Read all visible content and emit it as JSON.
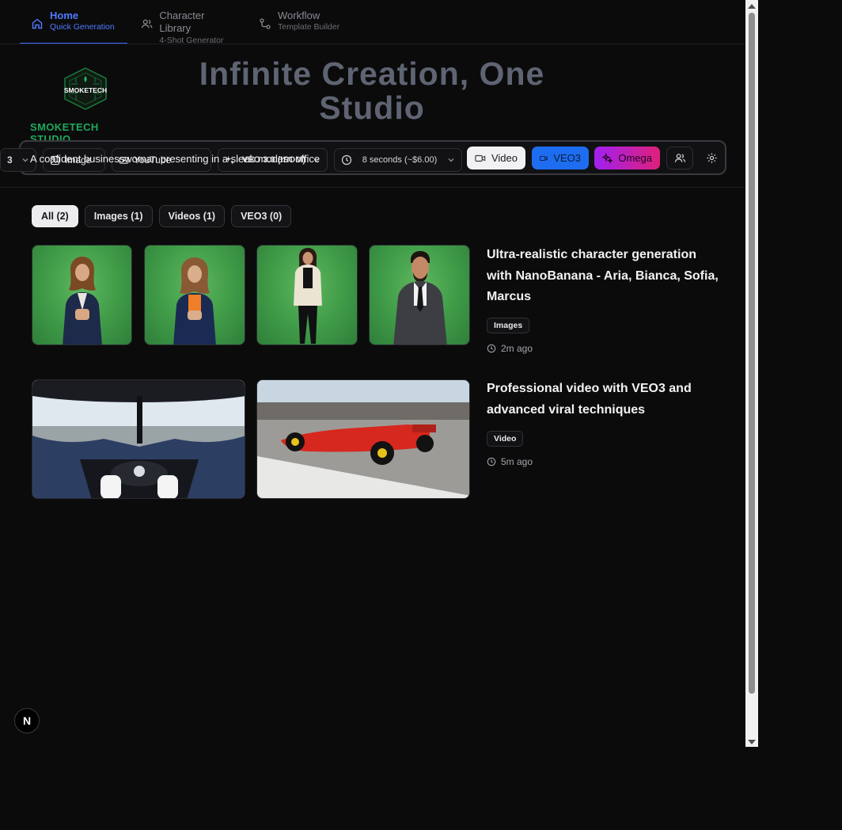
{
  "nav": {
    "items": [
      {
        "title": "Home",
        "subtitle": "Quick Generation"
      },
      {
        "title": "Character Library",
        "subtitle": "4-Shot Generator"
      },
      {
        "title": "Workflow",
        "subtitle": "Template Builder"
      }
    ]
  },
  "brand": {
    "name": "SMOKETECH STUDIO",
    "logo_text": "SMOKETECH",
    "accent": "#1fa85a"
  },
  "hero": {
    "title": "Infinite Creation, One Studio"
  },
  "promptbar": {
    "count": "3",
    "prompt": "A confident businesswoman presenting in a sleek modern office",
    "ghost_image": "Image",
    "ghost_youtube": "YouTube",
    "model": "VEO 3.0 (ISOM)",
    "duration": "8 seconds (~$6.00)",
    "video_label": "Video",
    "veo3_label": "VEO3",
    "omega_label": "Omega"
  },
  "filters": [
    {
      "label": "All (2)",
      "active": true
    },
    {
      "label": "Images (1)",
      "active": false
    },
    {
      "label": "Videos (1)",
      "active": false
    },
    {
      "label": "VEO3 (0)",
      "active": false
    }
  ],
  "entries": [
    {
      "title": "Ultra-realistic character generation with NanoBanana - Aria, Bianca, Sofia, Marcus",
      "badge": "Images",
      "time": "2m ago"
    },
    {
      "title": "Professional video with VEO3 and advanced viral techniques",
      "badge": "Video",
      "time": "5m ago"
    }
  ],
  "dev_badge": "N",
  "colors": {
    "background": "#0b0b0c",
    "nav_active": "#4f7bff",
    "veo3": "#1e6df0",
    "omega_start": "#a020f0",
    "omega_end": "#e0207a"
  }
}
